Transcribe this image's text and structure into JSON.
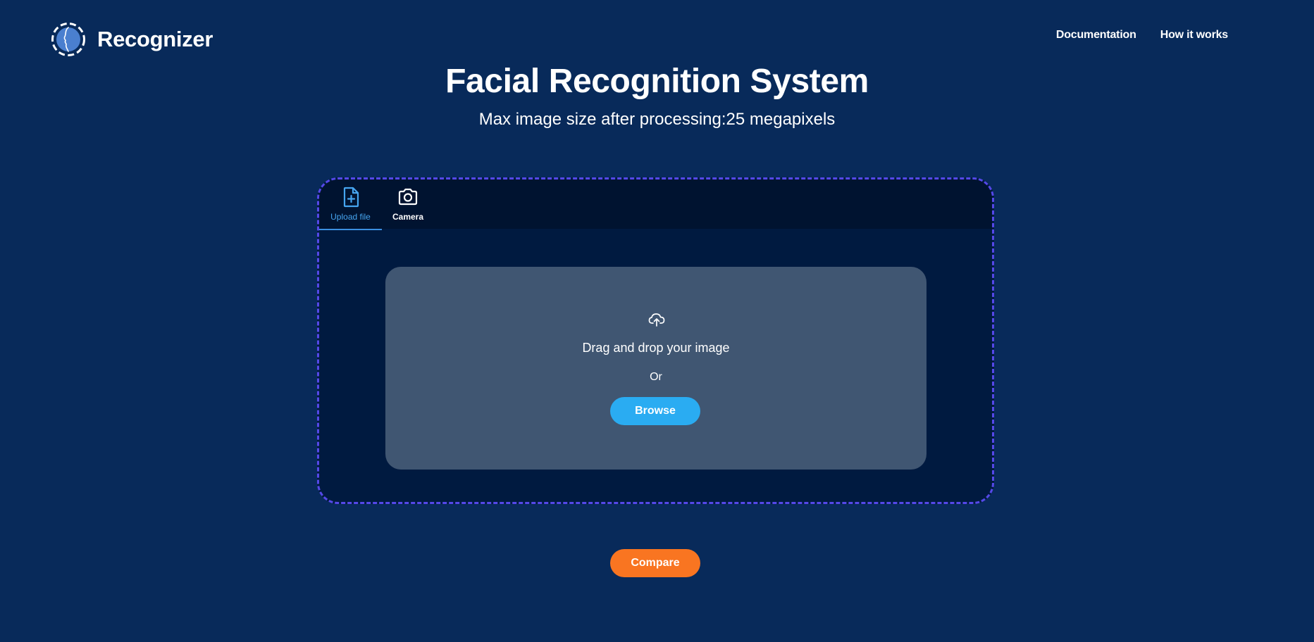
{
  "header": {
    "logo_icon": "face-profile-logo-icon",
    "logo_text": "Recognizer",
    "nav": {
      "documentation": "Documentation",
      "how_it_works": "How it works"
    }
  },
  "main": {
    "title": "Facial Recognition System",
    "subtitle": "Max image size after processing:25 megapixels"
  },
  "uploader": {
    "tabs": [
      {
        "label": "Upload file",
        "icon": "file-plus-icon",
        "active": true
      },
      {
        "label": "Camera",
        "icon": "camera-icon",
        "active": false
      }
    ],
    "dropzone": {
      "icon": "cloud-upload-icon",
      "drag_text": "Drag and drop your image",
      "or_text": "Or",
      "browse_label": "Browse"
    }
  },
  "actions": {
    "compare_label": "Compare"
  },
  "colors": {
    "background": "#082a5a",
    "panel": "#001a40",
    "tabbar": "#001330",
    "panel_border": "#5548e8",
    "dropzone": "#405672",
    "browse": "#2aacf2",
    "compare": "#f97521",
    "active_tab": "#46a5f0"
  }
}
